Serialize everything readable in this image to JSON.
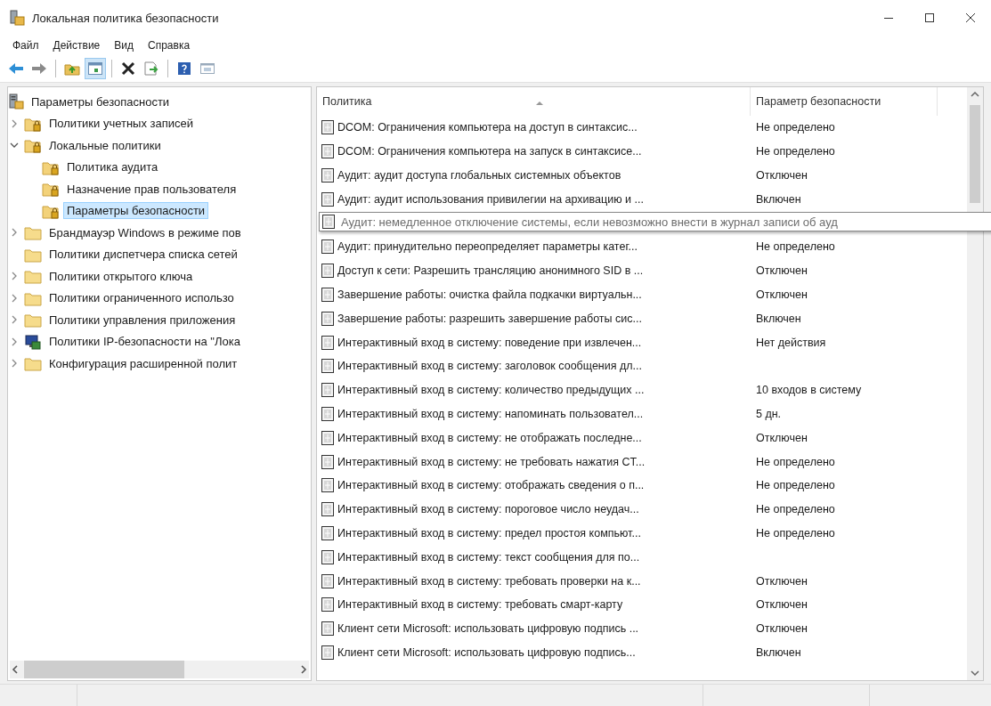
{
  "window": {
    "title": "Локальная политика безопасности"
  },
  "menu": [
    "Файл",
    "Действие",
    "Вид",
    "Справка"
  ],
  "toolbar": [
    {
      "kind": "back",
      "pressed": false
    },
    {
      "kind": "forward",
      "pressed": false
    },
    {
      "kind": "separator"
    },
    {
      "kind": "up",
      "pressed": false
    },
    {
      "kind": "tree",
      "pressed": true
    },
    {
      "kind": "separator"
    },
    {
      "kind": "delete",
      "pressed": false
    },
    {
      "kind": "export",
      "pressed": false
    },
    {
      "kind": "separator"
    },
    {
      "kind": "help",
      "pressed": false
    },
    {
      "kind": "properties",
      "pressed": false
    }
  ],
  "tree": {
    "root": {
      "label": "Параметры безопасности",
      "kind": "server",
      "selected": false,
      "children": [
        {
          "label": "Политики учетных записей",
          "kind": "secure-folder",
          "expanded": false,
          "selected": false
        },
        {
          "label": "Локальные политики",
          "kind": "secure-folder",
          "expanded": true,
          "selected": false,
          "children": [
            {
              "label": "Политика аудита",
              "kind": "secure-folder",
              "selected": false
            },
            {
              "label": "Назначение прав пользователя",
              "kind": "secure-folder",
              "selected": false
            },
            {
              "label": "Параметры безопасности",
              "kind": "secure-folder",
              "selected": true
            }
          ]
        },
        {
          "label": "Брандмауэр Windows в режиме пов",
          "kind": "folder",
          "expanded": false,
          "selected": false
        },
        {
          "label": "Политики диспетчера списка сетей",
          "kind": "folder",
          "selected": false
        },
        {
          "label": "Политики открытого ключа",
          "kind": "folder",
          "expanded": false,
          "selected": false
        },
        {
          "label": "Политики ограниченного использо",
          "kind": "folder",
          "expanded": false,
          "selected": false
        },
        {
          "label": "Политики управления приложения",
          "kind": "folder",
          "expanded": false,
          "selected": false
        },
        {
          "label": "Политики IP-безопасности на \"Лока",
          "kind": "monitor",
          "expanded": false,
          "selected": false
        },
        {
          "label": "Конфигурация расширенной полит",
          "kind": "folder",
          "expanded": false,
          "selected": false
        }
      ]
    }
  },
  "table": {
    "columns": [
      "Политика",
      "Параметр безопасности"
    ],
    "rows": [
      {
        "kind": "row",
        "policy": "DCOM: Ограничения компьютера на доступ в синтаксис...",
        "setting": "Не определено"
      },
      {
        "kind": "row",
        "policy": "DCOM: Ограничения компьютера на запуск в синтаксисе...",
        "setting": "Не определено"
      },
      {
        "kind": "row",
        "policy": "Аудит: аудит доступа глобальных системных объектов",
        "setting": "Отключен"
      },
      {
        "kind": "row",
        "policy": "Аудит: аудит использования привилегии на архивацию и ...",
        "setting": "Включен"
      },
      {
        "kind": "tooltip",
        "policy": "Аудит: немедленное отключение системы, если невозможно внести в журнал записи об ауд"
      },
      {
        "kind": "row",
        "policy": "Аудит: принудительно переопределяет параметры катег...",
        "setting": "Не определено"
      },
      {
        "kind": "row",
        "policy": "Доступ к сети: Разрешить трансляцию анонимного SID в ...",
        "setting": "Отключен"
      },
      {
        "kind": "row",
        "policy": "Завершение работы: очистка файла подкачки виртуальн...",
        "setting": "Отключен"
      },
      {
        "kind": "row",
        "policy": "Завершение работы: разрешить завершение работы сис...",
        "setting": "Включен"
      },
      {
        "kind": "row",
        "policy": "Интерактивный вход в систему:  поведение при извлечен...",
        "setting": "Нет действия"
      },
      {
        "kind": "row",
        "policy": "Интерактивный вход в систему: заголовок сообщения дл..."
      },
      {
        "kind": "row",
        "policy": "Интерактивный вход в систему: количество предыдущих ...",
        "setting": "10 входов в систему"
      },
      {
        "kind": "row",
        "policy": "Интерактивный вход в систему: напоминать пользовател...",
        "setting": "5 дн."
      },
      {
        "kind": "row",
        "policy": "Интерактивный вход в систему: не отображать последне...",
        "setting": "Отключен"
      },
      {
        "kind": "row",
        "policy": "Интерактивный вход в систему: не требовать нажатия CT...",
        "setting": "Не определено"
      },
      {
        "kind": "row",
        "policy": "Интерактивный вход в систему: отображать сведения о п...",
        "setting": "Не определено"
      },
      {
        "kind": "row",
        "policy": "Интерактивный вход в систему: пороговое число неудач...",
        "setting": "Не определено"
      },
      {
        "kind": "row",
        "policy": "Интерактивный вход в систему: предел простоя компьют...",
        "setting": "Не определено"
      },
      {
        "kind": "row",
        "policy": "Интерактивный вход в систему: текст сообщения для по..."
      },
      {
        "kind": "row",
        "policy": "Интерактивный вход в систему: требовать проверки на к...",
        "setting": "Отключен"
      },
      {
        "kind": "row",
        "policy": "Интерактивный вход в систему: требовать смарт-карту",
        "setting": "Отключен"
      },
      {
        "kind": "row",
        "policy": "Клиент сети Microsoft: использовать цифровую подпись ...",
        "setting": "Отключен"
      },
      {
        "kind": "row",
        "policy": "Клиент сети Microsoft: использовать цифровую подпись...",
        "setting": "Включен"
      }
    ]
  }
}
